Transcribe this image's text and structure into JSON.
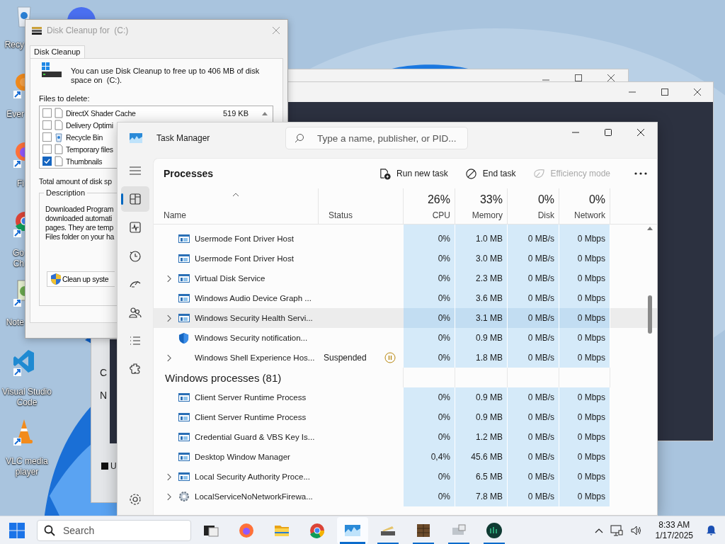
{
  "desktop": {
    "icons": [
      {
        "label": "Recy",
        "kind": "recycle-bin"
      },
      {
        "label": "Ever",
        "kind": "search-app"
      },
      {
        "label": "Fi",
        "kind": "firefox"
      },
      {
        "label": "Go Ch",
        "kind": "chrome"
      },
      {
        "label": "Note",
        "kind": "notepad"
      },
      {
        "label": "Visual Studio Code",
        "kind": "vscode"
      },
      {
        "label": "VLC media player",
        "kind": "vlc"
      }
    ]
  },
  "behind_window": {
    "lines": [
      "C",
      "N",
      "U"
    ]
  },
  "disk_cleanup": {
    "title": "Disk Cleanup for  (C:)",
    "tab": "Disk Cleanup",
    "intro": "You can use Disk Cleanup to free up to 406 MB of disk space on  (C:).",
    "files_label": "Files to delete:",
    "files": [
      {
        "name": "DirectX Shader Cache",
        "size": "519 KB",
        "checked": false,
        "kind": "file"
      },
      {
        "name": "Delivery Optimi",
        "checked": false,
        "kind": "file"
      },
      {
        "name": "Recycle Bin",
        "checked": false,
        "kind": "recycle"
      },
      {
        "name": "Temporary files",
        "checked": false,
        "kind": "file"
      },
      {
        "name": "Thumbnails",
        "checked": true,
        "kind": "file"
      }
    ],
    "total_label": "Total amount of disk sp",
    "description_label": "Description",
    "description_lines": [
      "Downloaded Program",
      "downloaded automati",
      "pages. They are temp",
      "Files folder on your ha"
    ],
    "cleanup_button": "Clean up syste"
  },
  "task_manager": {
    "title": "Task Manager",
    "search_placeholder": "Type a name, publisher, or PID...",
    "nav": [
      {
        "kind": "processes",
        "selected": true
      },
      {
        "kind": "performance",
        "selected": false
      },
      {
        "kind": "app-history",
        "selected": false
      },
      {
        "kind": "startup",
        "selected": false
      },
      {
        "kind": "users",
        "selected": false
      },
      {
        "kind": "details",
        "selected": false
      },
      {
        "kind": "services",
        "selected": false
      }
    ],
    "page_title": "Processes",
    "commands": [
      {
        "label": "Run new task",
        "kind": "run",
        "disabled": false
      },
      {
        "label": "End task",
        "kind": "end",
        "disabled": false
      },
      {
        "label": "Efficiency mode",
        "kind": "efficiency",
        "disabled": true
      }
    ],
    "columns": [
      {
        "label": "Name",
        "sorted": true
      },
      {
        "label": "Status",
        "sorted": false
      },
      {
        "percent": "26%",
        "label": "CPU",
        "sorted": false
      },
      {
        "percent": "33%",
        "label": "Memory",
        "sorted": false
      },
      {
        "percent": "0%",
        "label": "Disk",
        "sorted": false
      },
      {
        "percent": "0%",
        "label": "Network",
        "sorted": false
      }
    ],
    "sections": [
      {
        "rows": [
          {
            "name": "Usermode Font Driver Host",
            "kind": "window",
            "expandable": false,
            "highlighted": false,
            "cpu": "0%",
            "memory": "1.0 MB",
            "disk": "0 MB/s",
            "network": "0 Mbps"
          },
          {
            "name": "Usermode Font Driver Host",
            "kind": "window",
            "expandable": false,
            "highlighted": false,
            "cpu": "0%",
            "memory": "3.0 MB",
            "disk": "0 MB/s",
            "network": "0 Mbps"
          },
          {
            "name": "Virtual Disk Service",
            "kind": "window",
            "expandable": true,
            "highlighted": false,
            "cpu": "0%",
            "memory": "2.3 MB",
            "disk": "0 MB/s",
            "network": "0 Mbps"
          },
          {
            "name": "Windows Audio Device Graph ...",
            "kind": "window",
            "expandable": false,
            "highlighted": false,
            "cpu": "0%",
            "memory": "3.6 MB",
            "disk": "0 MB/s",
            "network": "0 Mbps"
          },
          {
            "name": "Windows Security Health Servi...",
            "kind": "window",
            "expandable": true,
            "highlighted": true,
            "cpu": "0%",
            "memory": "3.1 MB",
            "disk": "0 MB/s",
            "network": "0 Mbps"
          },
          {
            "name": "Windows Security notification...",
            "kind": "shield",
            "expandable": false,
            "highlighted": false,
            "cpu": "0%",
            "memory": "0.9 MB",
            "disk": "0 MB/s",
            "network": "0 Mbps"
          },
          {
            "name": "Windows Shell Experience Hos...",
            "kind": "plain",
            "expandable": true,
            "highlighted": false,
            "status": "Suspended",
            "cpu": "0%",
            "memory": "1.8 MB",
            "disk": "0 MB/s",
            "network": "0 Mbps"
          }
        ]
      },
      {
        "title": "Windows processes (81)",
        "rows": [
          {
            "name": "Client Server Runtime Process",
            "kind": "window",
            "expandable": false,
            "highlighted": false,
            "cpu": "0%",
            "memory": "0.9 MB",
            "disk": "0 MB/s",
            "network": "0 Mbps"
          },
          {
            "name": "Client Server Runtime Process",
            "kind": "window",
            "expandable": false,
            "highlighted": false,
            "cpu": "0%",
            "memory": "0.9 MB",
            "disk": "0 MB/s",
            "network": "0 Mbps"
          },
          {
            "name": "Credential Guard & VBS Key Is...",
            "kind": "window",
            "expandable": false,
            "highlighted": false,
            "cpu": "0%",
            "memory": "1.2 MB",
            "disk": "0 MB/s",
            "network": "0 Mbps"
          },
          {
            "name": "Desktop Window Manager",
            "kind": "window",
            "expandable": false,
            "highlighted": false,
            "cpu": "0,4%",
            "memory": "45.6 MB",
            "disk": "0 MB/s",
            "network": "0 Mbps"
          },
          {
            "name": "Local Security Authority Proce...",
            "kind": "window",
            "expandable": true,
            "highlighted": false,
            "cpu": "0%",
            "memory": "6.5 MB",
            "disk": "0 MB/s",
            "network": "0 Mbps"
          },
          {
            "name": "LocalServiceNoNetworkFirewa...",
            "kind": "gear",
            "expandable": true,
            "highlighted": false,
            "cpu": "0%",
            "memory": "7.8 MB",
            "disk": "0 MB/s",
            "network": "0 Mbps"
          }
        ]
      }
    ]
  },
  "taskbar": {
    "search_placeholder": "Search",
    "apps": [
      {
        "kind": "task-view",
        "running": false,
        "selected": false
      },
      {
        "kind": "firefox",
        "running": false,
        "selected": false
      },
      {
        "kind": "explorer",
        "running": false,
        "selected": false
      },
      {
        "kind": "chrome",
        "running": false,
        "selected": false
      },
      {
        "kind": "task-manager",
        "running": true,
        "selected": true
      },
      {
        "kind": "disk-cleanup",
        "running": true,
        "selected": false
      },
      {
        "kind": "crate",
        "running": true,
        "selected": false
      },
      {
        "kind": "device",
        "running": true,
        "selected": false
      },
      {
        "kind": "terminal",
        "running": true,
        "selected": false
      }
    ],
    "time": "8:33 AM",
    "date": "1/17/2025"
  }
}
